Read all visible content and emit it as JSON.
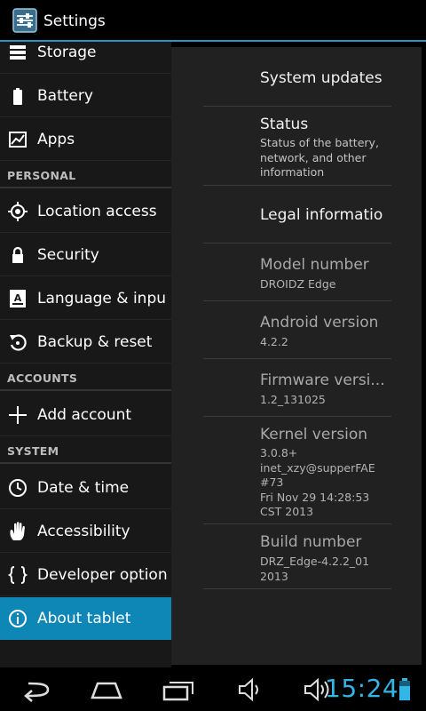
{
  "action_bar": {
    "title": "Settings"
  },
  "sidebar": {
    "items": [
      {
        "label": "Storage"
      },
      {
        "label": "Battery"
      },
      {
        "label": "Apps"
      },
      {
        "label": "PERSONAL"
      },
      {
        "label": "Location access"
      },
      {
        "label": "Security"
      },
      {
        "label": "Language & inpu"
      },
      {
        "label": "Backup & reset"
      },
      {
        "label": "ACCOUNTS"
      },
      {
        "label": "Add account"
      },
      {
        "label": "SYSTEM"
      },
      {
        "label": "Date & time"
      },
      {
        "label": "Accessibility"
      },
      {
        "label": "Developer option"
      },
      {
        "label": "About tablet"
      }
    ],
    "selected": "About tablet"
  },
  "about": {
    "items": [
      {
        "title": "System updates",
        "summary": ""
      },
      {
        "title": "Status",
        "summary": "Status of the battery,\nnetwork, and other\ninformation"
      },
      {
        "title": "Legal informatio",
        "summary": ""
      },
      {
        "title": "Model number",
        "summary": "DROIDZ Edge"
      },
      {
        "title": "Android version",
        "summary": "4.2.2"
      },
      {
        "title": "Firmware versi...",
        "summary": "1.2_131025"
      },
      {
        "title": "Kernel version",
        "summary": "3.0.8+\ninet_xzy@supperFAE\n#73\nFri Nov 29 14:28:53\nCST 2013"
      },
      {
        "title": "Build number",
        "summary": "DRZ_Edge-4.2.2_01\n2013"
      }
    ]
  },
  "status_bar": {
    "clock": "15:24"
  },
  "colors": {
    "accent": "#33b5e5",
    "selected": "#0e87b7"
  },
  "icons": [
    "settings-icon",
    "storage-icon",
    "battery-icon",
    "apps-icon",
    "location-icon",
    "lock-icon",
    "language-icon",
    "backup-icon",
    "add-icon",
    "clock-icon",
    "accessibility-icon",
    "developer-icon",
    "info-icon",
    "back-icon",
    "home-icon",
    "recent-apps-icon",
    "volume-down-icon",
    "volume-up-icon",
    "battery-status-icon"
  ]
}
